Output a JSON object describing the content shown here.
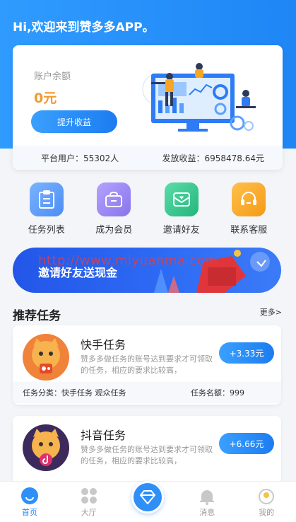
{
  "header": {
    "greeting": "Hi,欢迎来到赞多多APP。"
  },
  "balance": {
    "label": "账户余额",
    "value": "0元",
    "boost_button": "提升收益",
    "platform_users_text": "平台用户：55302人",
    "payout_text": "发放收益：6958478.64元"
  },
  "quick_actions": [
    {
      "label": "任务列表",
      "icon": "clipboard-icon",
      "color": "#5b9cf7"
    },
    {
      "label": "成为会员",
      "icon": "member-bag-icon",
      "color": "#9b86f0"
    },
    {
      "label": "邀请好友",
      "icon": "invite-mail-icon",
      "color": "#33c48d"
    },
    {
      "label": "联系客服",
      "icon": "headset-icon",
      "color": "#f6a623"
    }
  ],
  "banner": {
    "title": "邀请好友送现金",
    "watermark": "http://www.miyuanma.com"
  },
  "recommended": {
    "title": "推荐任务",
    "more": "更多>",
    "tasks": [
      {
        "name": "快手任务",
        "desc": "赞多多做任务的账号达到要求才可领取的任务，相应的要求比较高，",
        "reward": "+3.33元",
        "category_text": "任务分类：快手任务 观众任务",
        "quota_text": "任务名额：999",
        "avatar_color": "#f0823a"
      },
      {
        "name": "抖音任务",
        "desc": "赞多多做任务的账号达到要求才可领取的任务，相应的要求比较高，",
        "reward": "+6.66元",
        "avatar_color": "#3c2a5c"
      }
    ]
  },
  "tabbar": [
    {
      "label": "首页",
      "active": true
    },
    {
      "label": "大厅"
    },
    {
      "label": ""
    },
    {
      "label": "消息"
    },
    {
      "label": "我的"
    }
  ],
  "colors": {
    "primary": "#1f86f5",
    "accent_orange": "#f29a2e"
  }
}
